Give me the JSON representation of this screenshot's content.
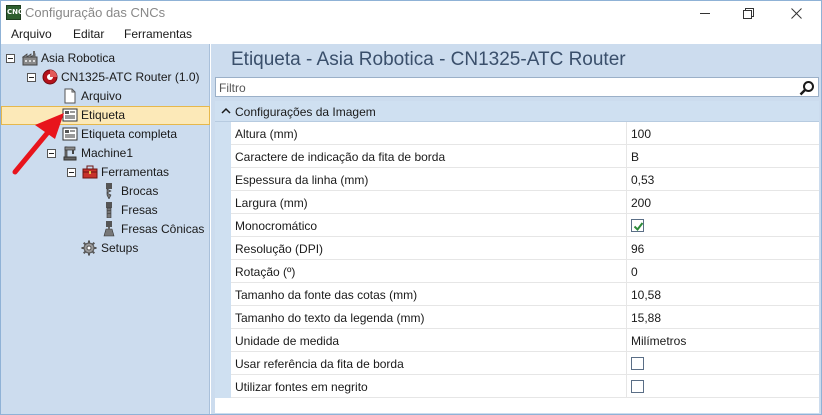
{
  "window": {
    "title": "Configuração das CNCs",
    "icon_text": "CNC"
  },
  "menu": [
    "Arquivo",
    "Editar",
    "Ferramentas"
  ],
  "tree": {
    "root": "Asia Robotica",
    "machine_group": "CN1325-ATC Router (1.0)",
    "items": {
      "arquivo": "Arquivo",
      "etiqueta": "Etiqueta",
      "etiqueta_completa": "Etiqueta completa",
      "machine": "Machine1",
      "ferramentas": "Ferramentas",
      "brocas": "Brocas",
      "fresas": "Fresas",
      "fresas_conicas": "Fresas Cônicas",
      "setups": "Setups"
    },
    "selected": "Etiqueta"
  },
  "panel": {
    "header": "Etiqueta - Asia Robotica - CN1325-ATC Router",
    "filter_placeholder": "Filtro",
    "category": "Configurações da Imagem",
    "properties": [
      {
        "name": "Altura (mm)",
        "value": "100",
        "type": "text"
      },
      {
        "name": "Caractere de indicação da fita de borda",
        "value": "B",
        "type": "text"
      },
      {
        "name": "Espessura da linha (mm)",
        "value": "0,53",
        "type": "text"
      },
      {
        "name": "Largura (mm)",
        "value": "200",
        "type": "text"
      },
      {
        "name": "Monocromático",
        "value": true,
        "type": "checkbox"
      },
      {
        "name": "Resolução (DPI)",
        "value": "96",
        "type": "text"
      },
      {
        "name": "Rotação (º)",
        "value": "0",
        "type": "text"
      },
      {
        "name": "Tamanho da fonte das cotas (mm)",
        "value": "10,58",
        "type": "text"
      },
      {
        "name": "Tamanho do texto da legenda (mm)",
        "value": "15,88",
        "type": "text"
      },
      {
        "name": "Unidade de medida",
        "value": "Milímetros",
        "type": "text"
      },
      {
        "name": "Usar referência da fita de borda",
        "value": false,
        "type": "checkbox"
      },
      {
        "name": "Utilizar fontes em negrito",
        "value": false,
        "type": "checkbox"
      }
    ]
  },
  "colors": {
    "pane_bg": "#ccdcee",
    "selection_bg": "#fce9b8",
    "arrow": "#e8141c",
    "check": "#2e8b3a"
  }
}
